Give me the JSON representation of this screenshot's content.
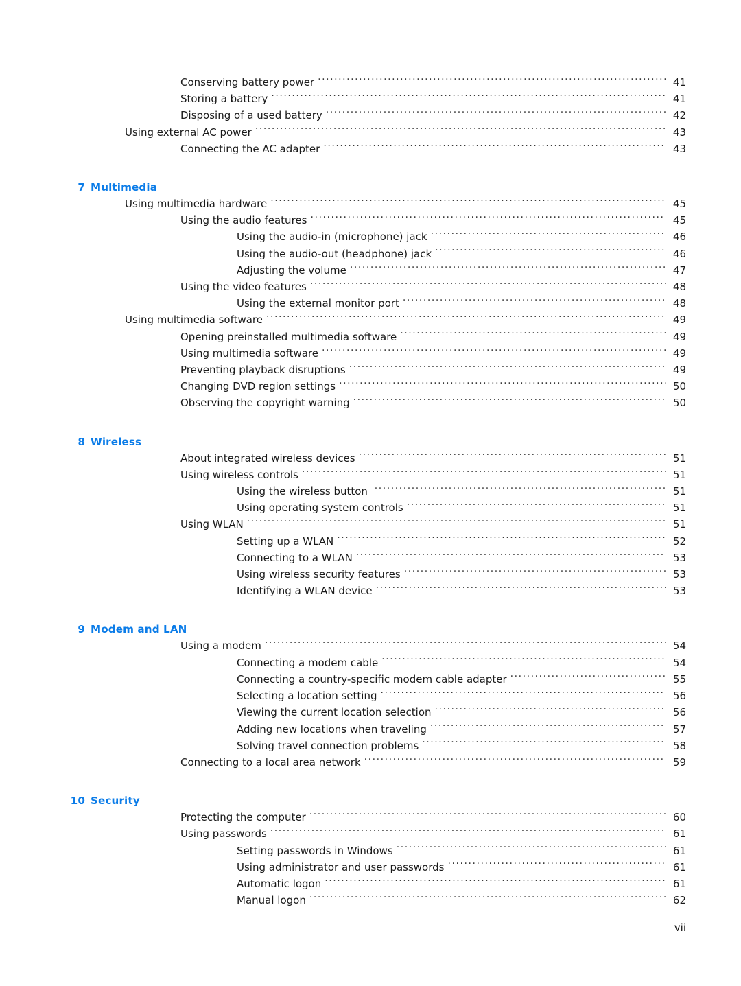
{
  "document": {
    "type": "table-of-contents",
    "page_label": "vii",
    "accent_color": "#0b7ce8",
    "text_color": "#1a1a1a"
  },
  "toc": {
    "leading_entries": [
      {
        "level": 2,
        "label": "Conserving battery power",
        "page": "41"
      },
      {
        "level": 2,
        "label": "Storing a battery",
        "page": "41"
      },
      {
        "level": 2,
        "label": "Disposing of a used battery",
        "page": "42"
      },
      {
        "level": 1,
        "label": "Using external AC power",
        "page": "43"
      },
      {
        "level": 2,
        "label": "Connecting the AC adapter",
        "page": "43"
      }
    ],
    "chapters": [
      {
        "number": "7",
        "title": "Multimedia",
        "entries": [
          {
            "level": 1,
            "label": "Using multimedia hardware",
            "page": "45"
          },
          {
            "level": 2,
            "label": "Using the audio features",
            "page": "45"
          },
          {
            "level": 3,
            "label": "Using the audio-in (microphone) jack",
            "page": "46"
          },
          {
            "level": 3,
            "label": "Using the audio-out (headphone) jack",
            "page": "46"
          },
          {
            "level": 3,
            "label": "Adjusting the volume",
            "page": "47"
          },
          {
            "level": 2,
            "label": "Using the video features",
            "page": "48"
          },
          {
            "level": 3,
            "label": "Using the external monitor port",
            "page": "48"
          },
          {
            "level": 1,
            "label": "Using multimedia software",
            "page": "49"
          },
          {
            "level": 2,
            "label": "Opening preinstalled multimedia software",
            "page": "49"
          },
          {
            "level": 2,
            "label": "Using multimedia software",
            "page": "49"
          },
          {
            "level": 2,
            "label": "Preventing playback disruptions",
            "page": "49"
          },
          {
            "level": 2,
            "label": "Changing DVD region settings",
            "page": "50"
          },
          {
            "level": 2,
            "label": "Observing the copyright warning",
            "page": "50"
          }
        ]
      },
      {
        "number": "8",
        "title": "Wireless",
        "entries": [
          {
            "level": 2,
            "label": "About integrated wireless devices",
            "page": "51"
          },
          {
            "level": 2,
            "label": "Using wireless controls",
            "page": "51"
          },
          {
            "level": 3,
            "label": "Using the wireless button ",
            "page": "51"
          },
          {
            "level": 3,
            "label": "Using operating system controls",
            "page": "51"
          },
          {
            "level": 2,
            "label": "Using WLAN",
            "page": "51"
          },
          {
            "level": 3,
            "label": "Setting up a WLAN",
            "page": "52"
          },
          {
            "level": 3,
            "label": "Connecting to a WLAN",
            "page": "53"
          },
          {
            "level": 3,
            "label": "Using wireless security features",
            "page": "53"
          },
          {
            "level": 3,
            "label": "Identifying a WLAN device",
            "page": "53"
          }
        ]
      },
      {
        "number": "9",
        "title": "Modem and LAN",
        "entries": [
          {
            "level": 2,
            "label": "Using a modem",
            "page": "54"
          },
          {
            "level": 3,
            "label": "Connecting a modem cable",
            "page": "54"
          },
          {
            "level": 3,
            "label": "Connecting a country-specific modem cable adapter",
            "page": "55"
          },
          {
            "level": 3,
            "label": "Selecting a location setting",
            "page": "56"
          },
          {
            "level": 4,
            "label": "Viewing the current location selection",
            "page": "56"
          },
          {
            "level": 4,
            "label": "Adding new locations when traveling",
            "page": "57"
          },
          {
            "level": 4,
            "label": "Solving travel connection problems",
            "page": "58"
          },
          {
            "level": 2,
            "label": "Connecting to a local area network",
            "page": "59"
          }
        ]
      },
      {
        "number": "10",
        "title": "Security",
        "entries": [
          {
            "level": 2,
            "label": "Protecting the computer",
            "page": "60"
          },
          {
            "level": 2,
            "label": "Using passwords",
            "page": "61"
          },
          {
            "level": 3,
            "label": "Setting passwords in Windows",
            "page": "61"
          },
          {
            "level": 3,
            "label": "Using administrator and user passwords",
            "page": "61"
          },
          {
            "level": 4,
            "label": "Automatic logon",
            "page": "61"
          },
          {
            "level": 4,
            "label": "Manual logon",
            "page": "62"
          }
        ]
      }
    ]
  }
}
